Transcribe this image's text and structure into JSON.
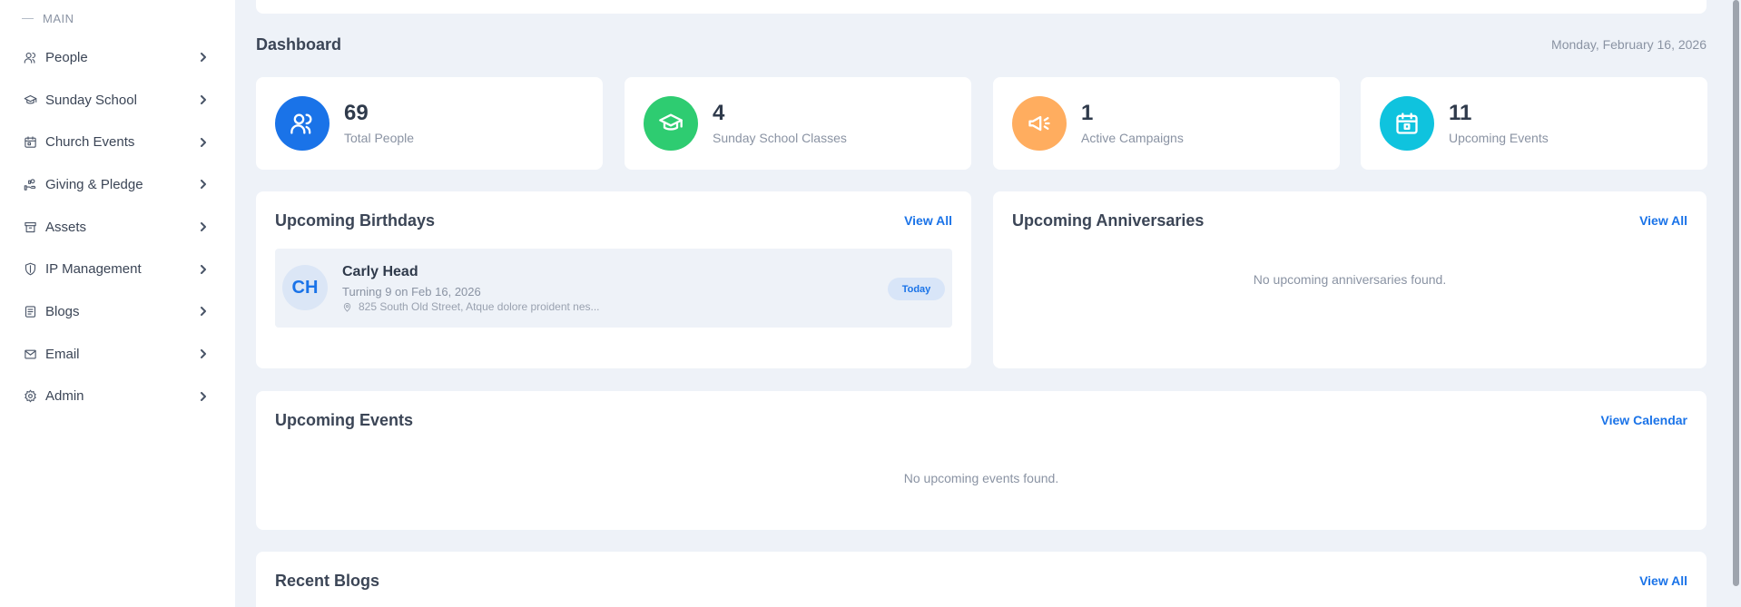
{
  "sidebar": {
    "section_label": "MAIN",
    "items": [
      {
        "label": "People",
        "icon": "users-icon"
      },
      {
        "label": "Sunday School",
        "icon": "graduation-cap-icon"
      },
      {
        "label": "Church Events",
        "icon": "calendar-icon"
      },
      {
        "label": "Giving & Pledge",
        "icon": "hand-coins-icon"
      },
      {
        "label": "Assets",
        "icon": "archive-box-icon"
      },
      {
        "label": "IP Management",
        "icon": "shield-icon"
      },
      {
        "label": "Blogs",
        "icon": "document-icon"
      },
      {
        "label": "Email",
        "icon": "mail-icon"
      },
      {
        "label": "Admin",
        "icon": "gear-icon"
      }
    ]
  },
  "header": {
    "title": "Dashboard",
    "date": "Monday, February 16, 2026"
  },
  "stats": [
    {
      "value": "69",
      "label": "Total People",
      "icon": "users-icon",
      "color": "#1a73e8"
    },
    {
      "value": "4",
      "label": "Sunday School Classes",
      "icon": "graduation-cap-icon",
      "color": "#2ecc71"
    },
    {
      "value": "1",
      "label": "Active Campaigns",
      "icon": "megaphone-icon",
      "color": "#ffad5f"
    },
    {
      "value": "11",
      "label": "Upcoming Events",
      "icon": "calendar-icon",
      "color": "#0fc3de"
    }
  ],
  "birthdays": {
    "title": "Upcoming Birthdays",
    "link": "View All",
    "items": [
      {
        "initials": "CH",
        "name": "Carly Head",
        "detail": "Turning 9 on Feb 16, 2026",
        "address": "825 South Old Street, Atque dolore proident nes...",
        "badge": "Today"
      }
    ]
  },
  "anniversaries": {
    "title": "Upcoming Anniversaries",
    "link": "View All",
    "empty": "No upcoming anniversaries found."
  },
  "events": {
    "title": "Upcoming Events",
    "link": "View Calendar",
    "empty": "No upcoming events found."
  },
  "blogs": {
    "title": "Recent Blogs",
    "link": "View All"
  },
  "colors": {
    "accent": "#1a73e8",
    "background": "#eef2f8"
  }
}
